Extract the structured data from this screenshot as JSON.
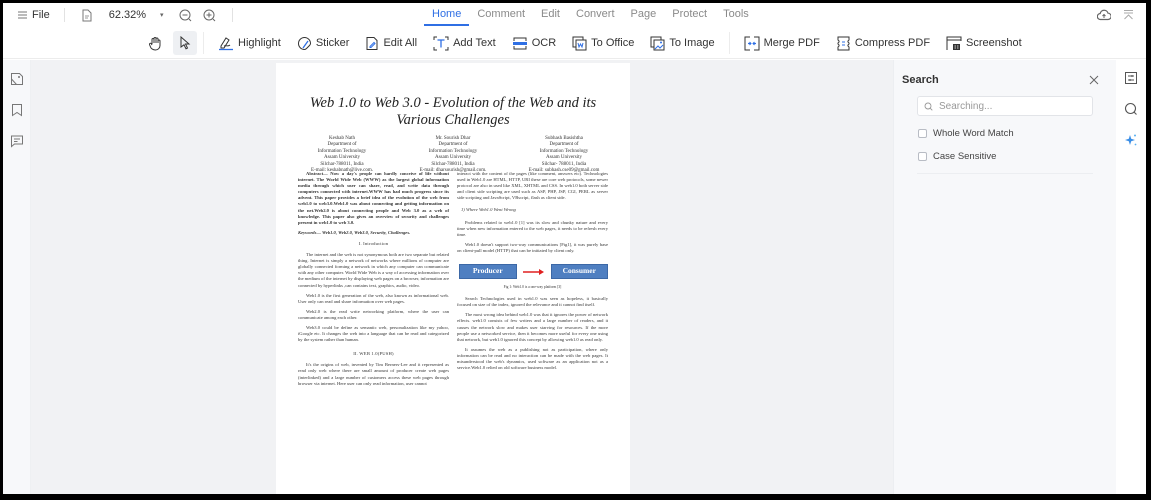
{
  "topbar": {
    "file_label": "File",
    "zoom_level": "62.32%",
    "tabs": [
      {
        "label": "Home",
        "active": true
      },
      {
        "label": "Comment",
        "active": false
      },
      {
        "label": "Edit",
        "active": false
      },
      {
        "label": "Convert",
        "active": false
      },
      {
        "label": "Page",
        "active": false
      },
      {
        "label": "Protect",
        "active": false
      },
      {
        "label": "Tools",
        "active": false
      }
    ]
  },
  "toolbar": {
    "tools": [
      {
        "label": "Highlight",
        "icon": "highlight-icon"
      },
      {
        "label": "Sticker",
        "icon": "sticker-icon"
      },
      {
        "label": "Edit All",
        "icon": "edit-all-icon"
      },
      {
        "label": "Add Text",
        "icon": "add-text-icon"
      },
      {
        "label": "OCR",
        "icon": "ocr-icon"
      },
      {
        "label": "To Office",
        "icon": "to-office-icon"
      },
      {
        "label": "To Image",
        "icon": "to-image-icon"
      },
      {
        "label": "Merge PDF",
        "icon": "merge-pdf-icon"
      },
      {
        "label": "Compress PDF",
        "icon": "compress-pdf-icon"
      },
      {
        "label": "Screenshot",
        "icon": "screenshot-icon"
      }
    ]
  },
  "colors": {
    "accent": "#2f6fe4",
    "figure_box": "#4f7fc1",
    "figure_arrow": "#e02020"
  },
  "document": {
    "title_line1": "Web 1.0 to Web 3.0 - Evolution of the Web and its",
    "title_line2": "Various Challenges",
    "authors": [
      {
        "name": "Keshab Nath",
        "dept1": "Department of",
        "dept2": "Information Technology",
        "univ": "Assam University",
        "place": "Silchar-788011, India",
        "email": "E-mail: keshabnath@live.com."
      },
      {
        "name": "Mr. Sourish Dhar",
        "dept1": "Department of",
        "dept2": "Information Technology",
        "univ": "Assam University",
        "place": "Silchar-788011, India",
        "email": "E-mail: dharsourish@gmail.com."
      },
      {
        "name": "Subhash Basishtha",
        "dept1": "Department of",
        "dept2": "Information Technology",
        "univ": "Assam University",
        "place": "Silchar- 788011, India",
        "email": "E-mail: subhash.cse09@gmail.com"
      }
    ],
    "abstract": "Abstract— Now a day's people can hardly conceive of life without internet. The World Wide Web (WWW) as the largest global information media through which user can share, read, and write data through computers connected with internet.WWW has had much progress since its advent. This paper provides a brief idea of the evolution of the web from web1.0 to web3.0.Web1.0 was about connecting and getting information on the net.Web2.0 is about connecting people and Web 3.0 as a web of knowledge. This paper also gives an overview of security and challenges present in web1.0 to web 3.0.",
    "keywords": "Keywords— Web1.0, Web2.0, Web3.0, Security, Challenges.",
    "section1_heading": "I.    Introduction",
    "intro_p1": "The internet and the web is not synonymous both are two separate but related thing. Internet is simply a network of networks where millions of computer are globally connected forming a network in which any computer can communicate with any other computer. World Wide Web is a way of accessing information over the medium of the internet by displaying web pages on a browser, information are connected by hyperlinks ,can contains text, graphics, audio, video.",
    "intro_p2": "Web1.0 is the first generation of the web, also known as informational web. User only can read and share information over web pages.",
    "intro_p3": "Web2.0 is the read write networking platform, where the user can communicate among each other.",
    "intro_p4": "Web3.0 could be define as semantic web, personalization like my yahoo, iGoogle etc. It changes the web into a language that can be read and categorized by the system rather than human.",
    "section2_heading": "II.    WEB 1.0(PUSH)",
    "web1_p1": "It's the origins of web, invented by Tim Berners-Lee and it represented as read only web where there are small amount of producer create web pages (interlinked) and a large number of customers access these web pages through browser via internet. Here user can only read information, user cannot",
    "right_p1": "interact with the content of the pages (like comment, answers etc). Technologies used in Web1.0 are HTML, HTTP, URI these are core web protocols, some newer protocol are also in used like XML, XHTML and CSS. In web1.0 both server side and client side scripting are used such as ASP, PHP, JSP, CGI, PERL as server side scripting and JavaScript, VBscript, flash as client side.",
    "subsection_a": "1)   Where Web1.0 Went Wrong",
    "right_p2": "Problems related to web1.0 [1] was its slow and chunky nature and every time when new information entered to the web pages, it needs to be refresh every time.",
    "right_p3": "Web1.0 doesn't support two-way communications [Fig1], it was purely base on client-pull model (HTTP) that can be initiated by client only.",
    "figure": {
      "producer": "Producer",
      "consumer": "Consumer",
      "caption": "Fig 1: Web1.0 is a one-way platform [3]"
    },
    "right_p4": "Search Technologies used in web1.0 was seen as hopeless, it basically focused on size of the index, ignored the relevance and it cannot find itself.",
    "right_p5": "The most wrong idea behind web1.0 was that it ignores the power of network effects. web1.0 consists of few writers and a large number of readers, and it causes the network slow and makes user starving for resources. If the more people use a networked service, then it becomes more useful for every one using that network, but web1.0 ignored this concept by allowing web1.0 as read only.",
    "right_p6": "It assumes the web as a publishing not as participation, where only information can be read and no interaction can be made with the web pages. It misunderstood the web's dynamics, used software as an application not as a service.Web1.0 relied on old software business model."
  },
  "search_panel": {
    "title": "Search",
    "placeholder": "Searching...",
    "options": [
      {
        "label": "Whole Word Match",
        "checked": false
      },
      {
        "label": "Case Sensitive",
        "checked": false
      }
    ]
  }
}
